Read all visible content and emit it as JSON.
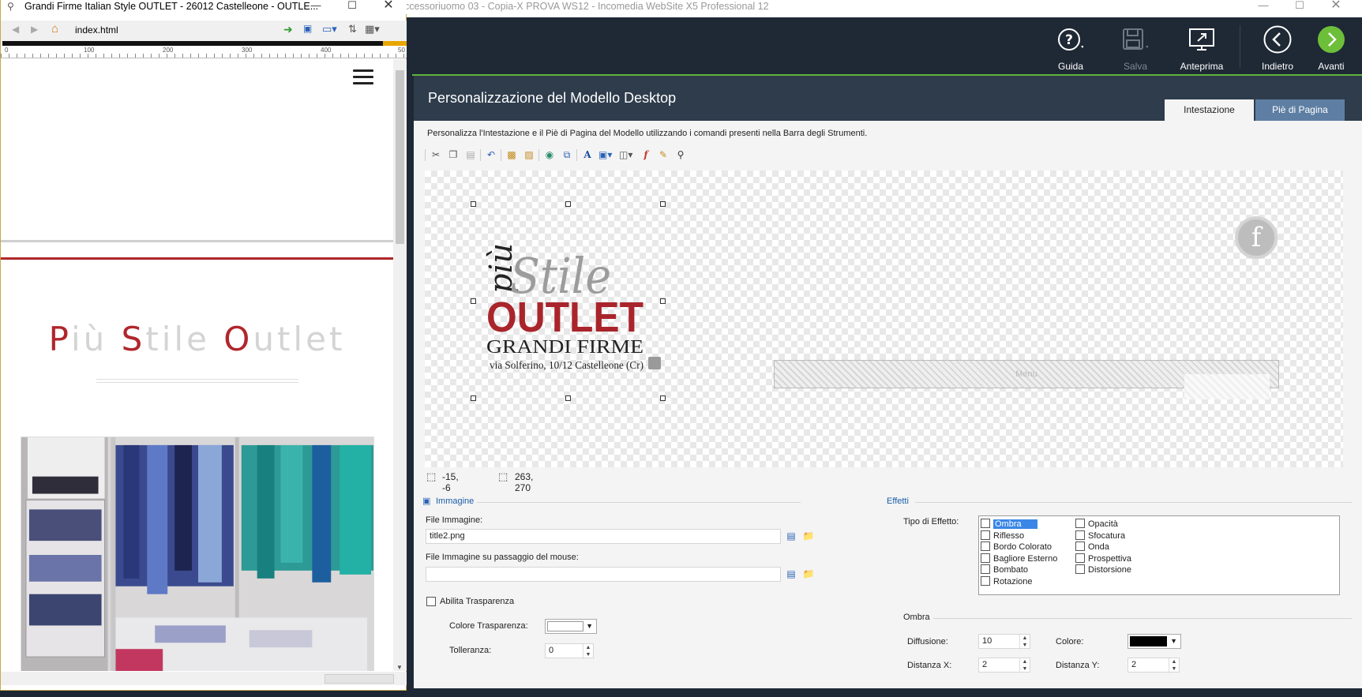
{
  "preview": {
    "title": "Grandi Firme Italian Style OUTLET - 26012 Castelleone - OUTLE...",
    "address": "index.html",
    "ruler_labels": [
      "0",
      "100",
      "200",
      "300",
      "400",
      "50"
    ],
    "site_title": {
      "p": "P",
      "iu": "iù ",
      "s": "S",
      "tile": "tile ",
      "o": "O",
      "utlet": "utlet"
    }
  },
  "app": {
    "title": "ccessoriuomo 03 - Copia-X PROVA WS12 - Incomedia WebSite X5 Professional 12",
    "toolbar": {
      "help": "Guida",
      "save": "Salva",
      "preview": "Anteprima",
      "back": "Indietro",
      "next": "Avanti"
    },
    "panel": {
      "title": "Personalizzazione del Modello Desktop",
      "tabs": [
        "Intestazione",
        "Piè di Pagina"
      ],
      "description": "Personalizza l'Intestazione e il Piè di Pagina del Modello utilizzando i comandi presenti nella Barra degli Strumenti."
    },
    "canvas": {
      "logo": {
        "piu": "più",
        "stile": "Stile",
        "outlet": "OUTLET",
        "grandi": "GRANDI FIRME",
        "address": "via Solferino, 10/12 Castelleone (Cr)"
      },
      "menu_placeholder": "Menu",
      "fb_glyph": "f"
    },
    "coords": {
      "position": "-15, -6",
      "size": "263, 270"
    },
    "image_group": {
      "title": "Immagine",
      "file_label": "File Immagine:",
      "file_value": "title2.png",
      "hover_label": "File Immagine su passaggio del mouse:",
      "hover_value": "",
      "transparency_label": "Abilita Trasparenza",
      "transparency_color_label": "Colore Trasparenza:",
      "tolerance_label": "Tolleranza:",
      "tolerance_value": "0"
    },
    "effects_group": {
      "title": "Effetti",
      "type_label": "Tipo di Effetto:",
      "col1": [
        "Ombra",
        "Riflesso",
        "Bordo Colorato",
        "Bagliore Esterno",
        "Bombato",
        "Rotazione"
      ],
      "col2": [
        "Opacità",
        "Sfocatura",
        "Onda",
        "Prospettiva",
        "Distorsione"
      ],
      "selected": "Ombra"
    },
    "shadow_group": {
      "title": "Ombra",
      "diffusion_label": "Diffusione:",
      "diffusion_value": "10",
      "color_label": "Colore:",
      "dx_label": "Distanza X:",
      "dx_value": "2",
      "dy_label": "Distanza Y:",
      "dy_value": "2"
    },
    "colors": {
      "accent_green": "#5fb33a",
      "panel_dark": "#2e3c4c",
      "brand_red": "#b0262c"
    }
  }
}
